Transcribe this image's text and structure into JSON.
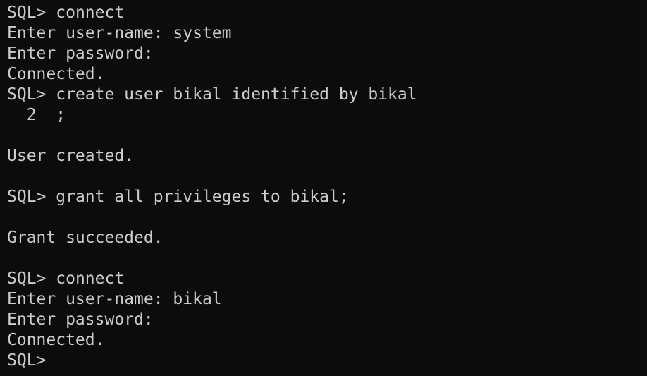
{
  "terminal": {
    "lines": [
      {
        "prompt": "SQL> ",
        "text": "connect"
      },
      {
        "prompt": "",
        "text": "Enter user-name: system"
      },
      {
        "prompt": "",
        "text": "Enter password:"
      },
      {
        "prompt": "",
        "text": "Connected."
      },
      {
        "prompt": "SQL> ",
        "text": "create user bikal identified by bikal"
      },
      {
        "prompt": "  2  ",
        "text": ";"
      },
      {
        "prompt": "",
        "text": ""
      },
      {
        "prompt": "",
        "text": "User created."
      },
      {
        "prompt": "",
        "text": ""
      },
      {
        "prompt": "SQL> ",
        "text": "grant all privileges to bikal;"
      },
      {
        "prompt": "",
        "text": ""
      },
      {
        "prompt": "",
        "text": "Grant succeeded."
      },
      {
        "prompt": "",
        "text": ""
      },
      {
        "prompt": "SQL> ",
        "text": "connect"
      },
      {
        "prompt": "",
        "text": "Enter user-name: bikal"
      },
      {
        "prompt": "",
        "text": "Enter password:"
      },
      {
        "prompt": "",
        "text": "Connected."
      },
      {
        "prompt": "SQL>",
        "text": ""
      }
    ]
  }
}
